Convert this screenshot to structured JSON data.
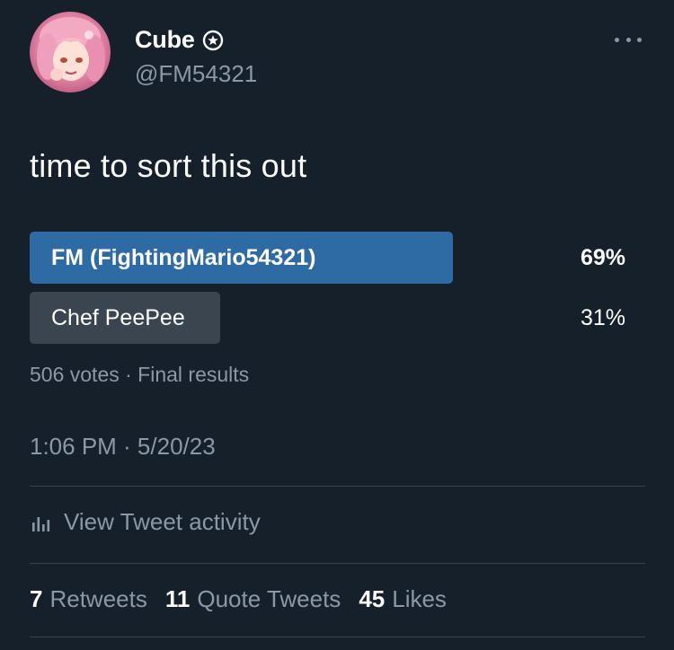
{
  "author": {
    "display_name": "Cube",
    "handle": "@FM54321",
    "badge_icon": "verified-badge-icon",
    "avatar_icon": "anime-avatar"
  },
  "tweet": {
    "text": "time to sort this out"
  },
  "poll": {
    "options": [
      {
        "label": "FM (FightingMario54321)",
        "percent_label": "69%",
        "percent": 69,
        "winner": true
      },
      {
        "label": "Chef PeePee",
        "percent_label": "31%",
        "percent": 31,
        "winner": false
      }
    ],
    "meta": "506 votes · Final results"
  },
  "timestamp": "1:06 PM · 5/20/23",
  "activity": {
    "label": "View Tweet activity",
    "icon": "analytics-icon"
  },
  "stats": [
    {
      "count": "7",
      "label": "Retweets"
    },
    {
      "count": "11",
      "label": "Quote Tweets"
    },
    {
      "count": "45",
      "label": "Likes"
    }
  ],
  "colors": {
    "background": "#15202b",
    "winner_bar": "#2e6aa3",
    "loser_bar": "#3a4550",
    "secondary_text": "#8b98a5",
    "divider": "#38444d"
  }
}
